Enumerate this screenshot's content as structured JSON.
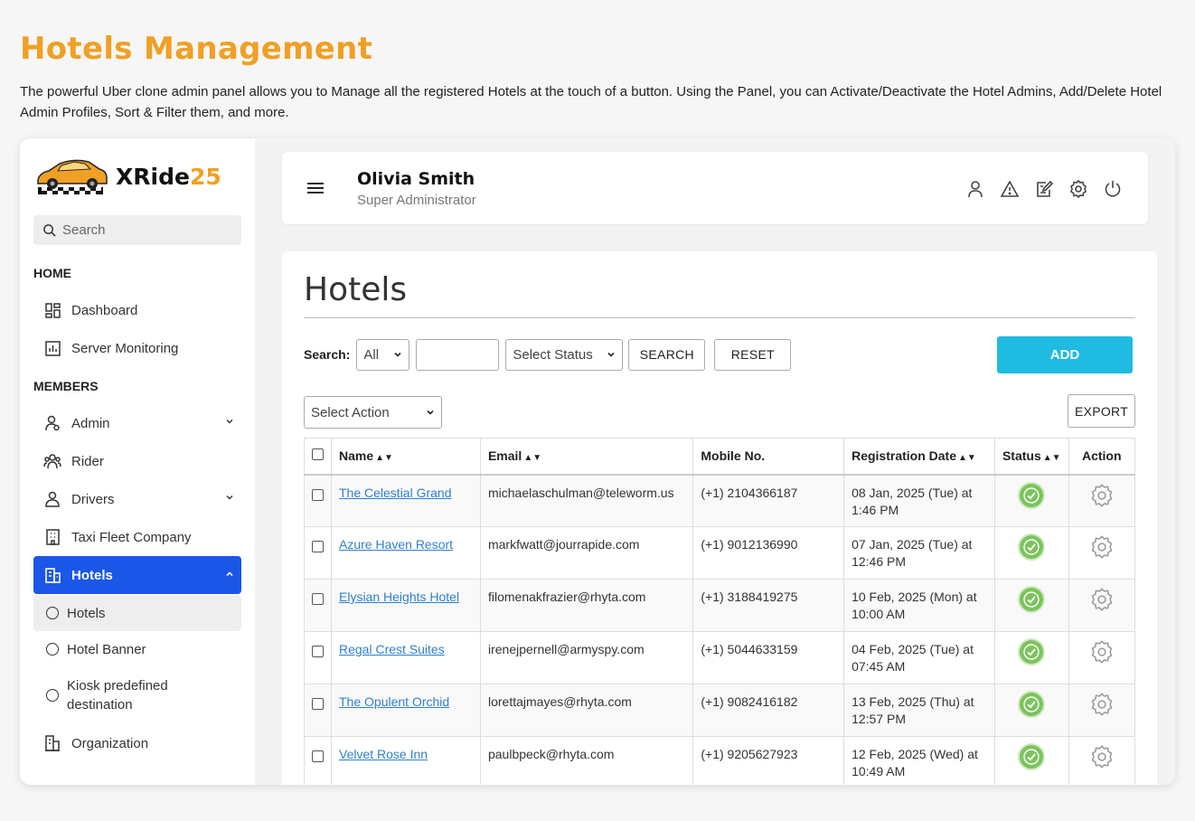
{
  "promo": {
    "title": "Hotels Management",
    "description": "The powerful Uber clone admin panel allows you to Manage all the registered Hotels at the touch of a button. Using the Panel, you can Activate/Deactivate the Hotel Admins, Add/Delete Hotel Admin Profiles, Sort & Filter them, and more."
  },
  "logo": {
    "text_main": "XRide",
    "text_num": "25"
  },
  "sidebar": {
    "search_placeholder": "Search",
    "sections": {
      "home": "HOME",
      "members": "MEMBERS"
    },
    "items": {
      "dashboard": "Dashboard",
      "server_monitoring": "Server Monitoring",
      "admin": "Admin",
      "rider": "Rider",
      "drivers": "Drivers",
      "taxi_fleet": "Taxi Fleet Company",
      "hotels": "Hotels",
      "sub_hotels": "Hotels",
      "hotel_banner": "Hotel Banner",
      "kiosk": "Kiosk predefined destination",
      "organization": "Organization"
    }
  },
  "header": {
    "user_name": "Olivia Smith",
    "user_role": "Super Administrator"
  },
  "page": {
    "title": "Hotels",
    "search_label": "Search:",
    "search_field_value": "All",
    "status_select": "Select Status",
    "search_button": "SEARCH",
    "reset_button": "RESET",
    "add_button": "ADD",
    "action_select": "Select Action",
    "export_button": "EXPORT"
  },
  "table": {
    "headers": {
      "name": "Name",
      "email": "Email",
      "mobile": "Mobile No.",
      "reg_date": "Registration Date",
      "status": "Status",
      "action": "Action"
    },
    "rows": [
      {
        "name": "The Celestial Grand",
        "email": "michaelaschulman@teleworm.us",
        "mobile": "(+1) 2104366187",
        "date1": "08 Jan, 2025 (Tue) at",
        "date2": "1:46 PM"
      },
      {
        "name": "Azure Haven Resort",
        "email": "markfwatt@jourrapide.com",
        "mobile": "(+1) 9012136990",
        "date1": "07 Jan, 2025 (Tue) at",
        "date2": "12:46 PM"
      },
      {
        "name": "Elysian Heights Hotel",
        "email": "filomenakfrazier@rhyta.com",
        "mobile": "(+1) 3188419275",
        "date1": "10 Feb, 2025 (Mon) at",
        "date2": "10:00 AM"
      },
      {
        "name": "Regal Crest Suites",
        "email": "irenejpernell@armyspy.com",
        "mobile": "(+1) 5044633159",
        "date1": "04 Feb, 2025 (Tue) at",
        "date2": "07:45 AM"
      },
      {
        "name": "The Opulent Orchid",
        "email": "lorettajmayes@rhyta.com",
        "mobile": "(+1) 9082416182",
        "date1": "13 Feb, 2025 (Thu) at",
        "date2": "12:57 PM"
      },
      {
        "name": "Velvet Rose Inn",
        "email": "paulbpeck@rhyta.com",
        "mobile": "(+1) 9205627923",
        "date1": "12 Feb, 2025 (Wed) at",
        "date2": "10:49 AM"
      }
    ]
  }
}
